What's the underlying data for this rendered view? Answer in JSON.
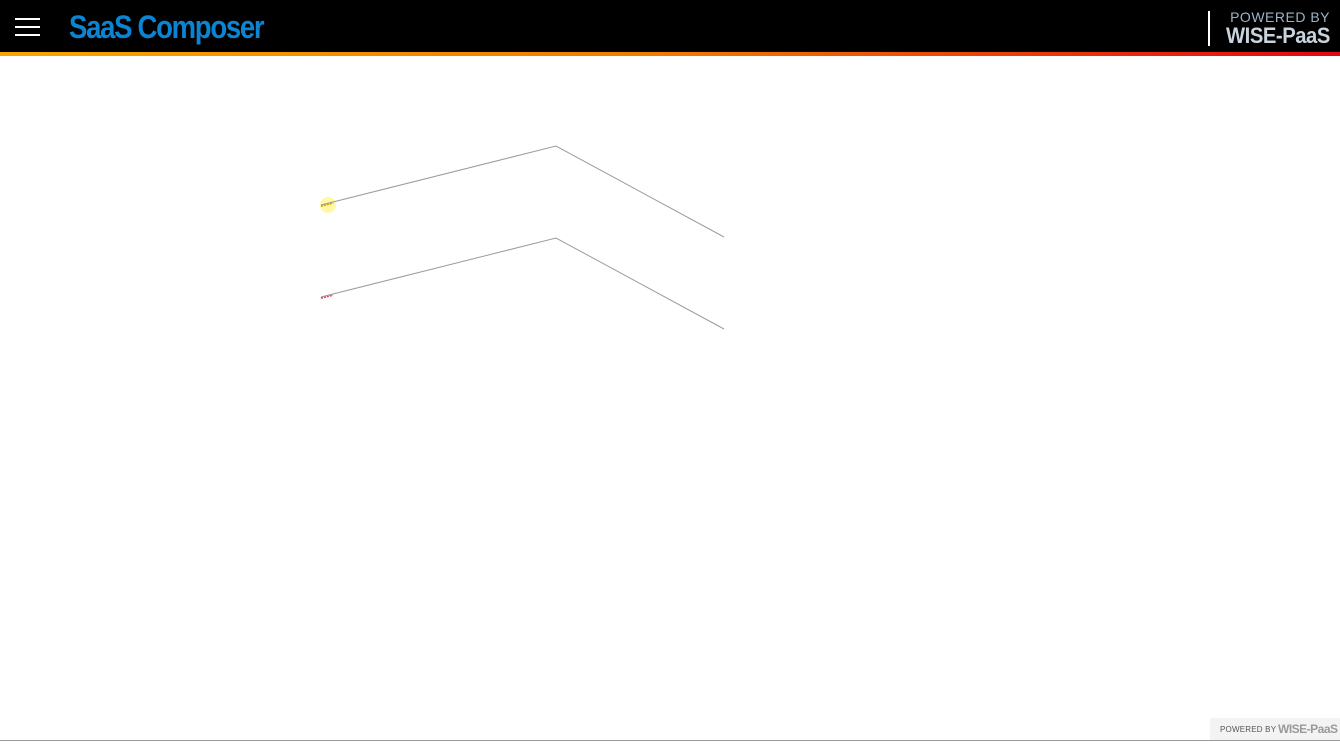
{
  "header": {
    "app_title": "SaaS Composer",
    "powered_by_label": "POWERED BY",
    "brand": "WISE-PaaS",
    "menu_icon": "hamburger-menu-icon",
    "background_color": "#000000",
    "title_color": "#0b84d2",
    "stripe_colors": [
      "#f7a600",
      "#f07a00",
      "#e30613"
    ]
  },
  "canvas": {
    "connectors": [
      {
        "name": "connector-line-1",
        "start_marker_color": "#ffe94a"
      },
      {
        "name": "connector-line-2",
        "start_marker_color": "#e84060"
      }
    ],
    "line_color": "#9c9c9c"
  },
  "footer": {
    "powered_by_label": "POWERED BY",
    "brand": "WISE-PaaS"
  }
}
